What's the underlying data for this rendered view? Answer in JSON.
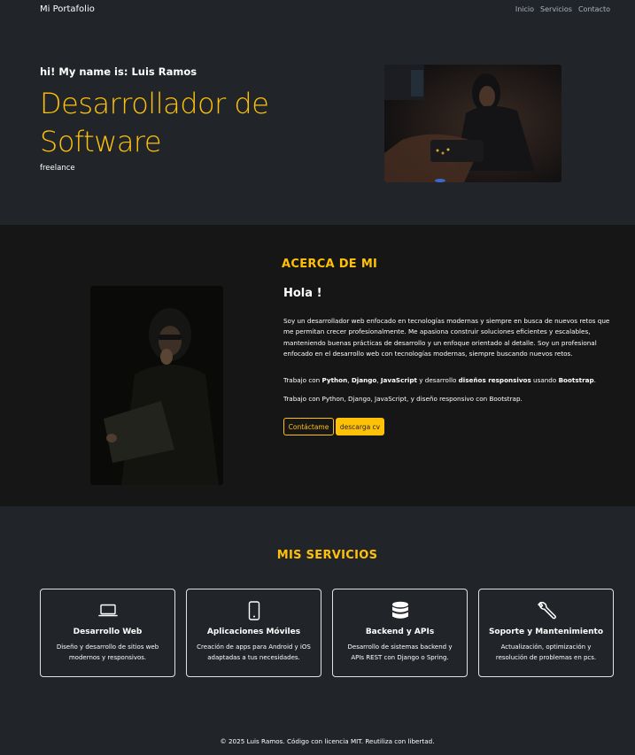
{
  "nav": {
    "brand": "Mi Portafolio",
    "links": [
      "Inicio",
      "Servicios",
      "Contacto"
    ]
  },
  "hero": {
    "intro": "hi! My name is: Luis Ramos",
    "title": "Desarrollador de Software",
    "subtitle": "freelance"
  },
  "about": {
    "heading": "ACERCA DE MI",
    "hello": "Hola !",
    "paragraph": "Soy un desarrollador web enfocado en tecnologías modernas y siempre en busca de nuevos retos que me permitan crecer profesionalmente. Me apasiona construir soluciones eficientes y escalables, manteniendo buenas prácticas de desarrollo y un enfoque orientado al detalle. Soy un profesional enfocado en el desarrollo web con tecnologías modernas, siempre buscando nuevos retos.",
    "line1": {
      "t1": "Trabajo con ",
      "b1": "Python",
      "t2": ", ",
      "b2": "Django",
      "t3": ", ",
      "b3": "JavaScript",
      "t4": " y desarrollo ",
      "b4": "diseños responsivos",
      "t5": " usando ",
      "b5": "Bootstrap",
      "t6": "."
    },
    "line2": "Trabajo con Python, Django, JavaScript, y diseño responsivo con Bootstrap.",
    "btn_contact": "Contáctame",
    "btn_cv": "descarga cv"
  },
  "services": {
    "heading": "MIS SERVICIOS",
    "cards": [
      {
        "icon": "laptop-icon",
        "title": "Desarrollo Web",
        "desc": "Diseño y desarrollo de sitios web modernos y responsivos."
      },
      {
        "icon": "phone-icon",
        "title": "Aplicaciones Móviles",
        "desc": "Creación de apps para Android y iOS adaptadas a tus necesidades."
      },
      {
        "icon": "database-icon",
        "title": "Backend y APIs",
        "desc": "Desarrollo de sistemas backend y APIs REST con Django o Spring."
      },
      {
        "icon": "wrench-icon",
        "title": "Soporte y Mantenimiento",
        "desc": "Actualización, optimización y resolución de problemas en pcs."
      }
    ]
  },
  "footer": {
    "text": "© 2025 Luis Ramos. Código con licencia MIT. Reutiliza con libertad."
  },
  "colors": {
    "accent": "#ffc107",
    "background": "#212529",
    "about_background": "#161616"
  }
}
